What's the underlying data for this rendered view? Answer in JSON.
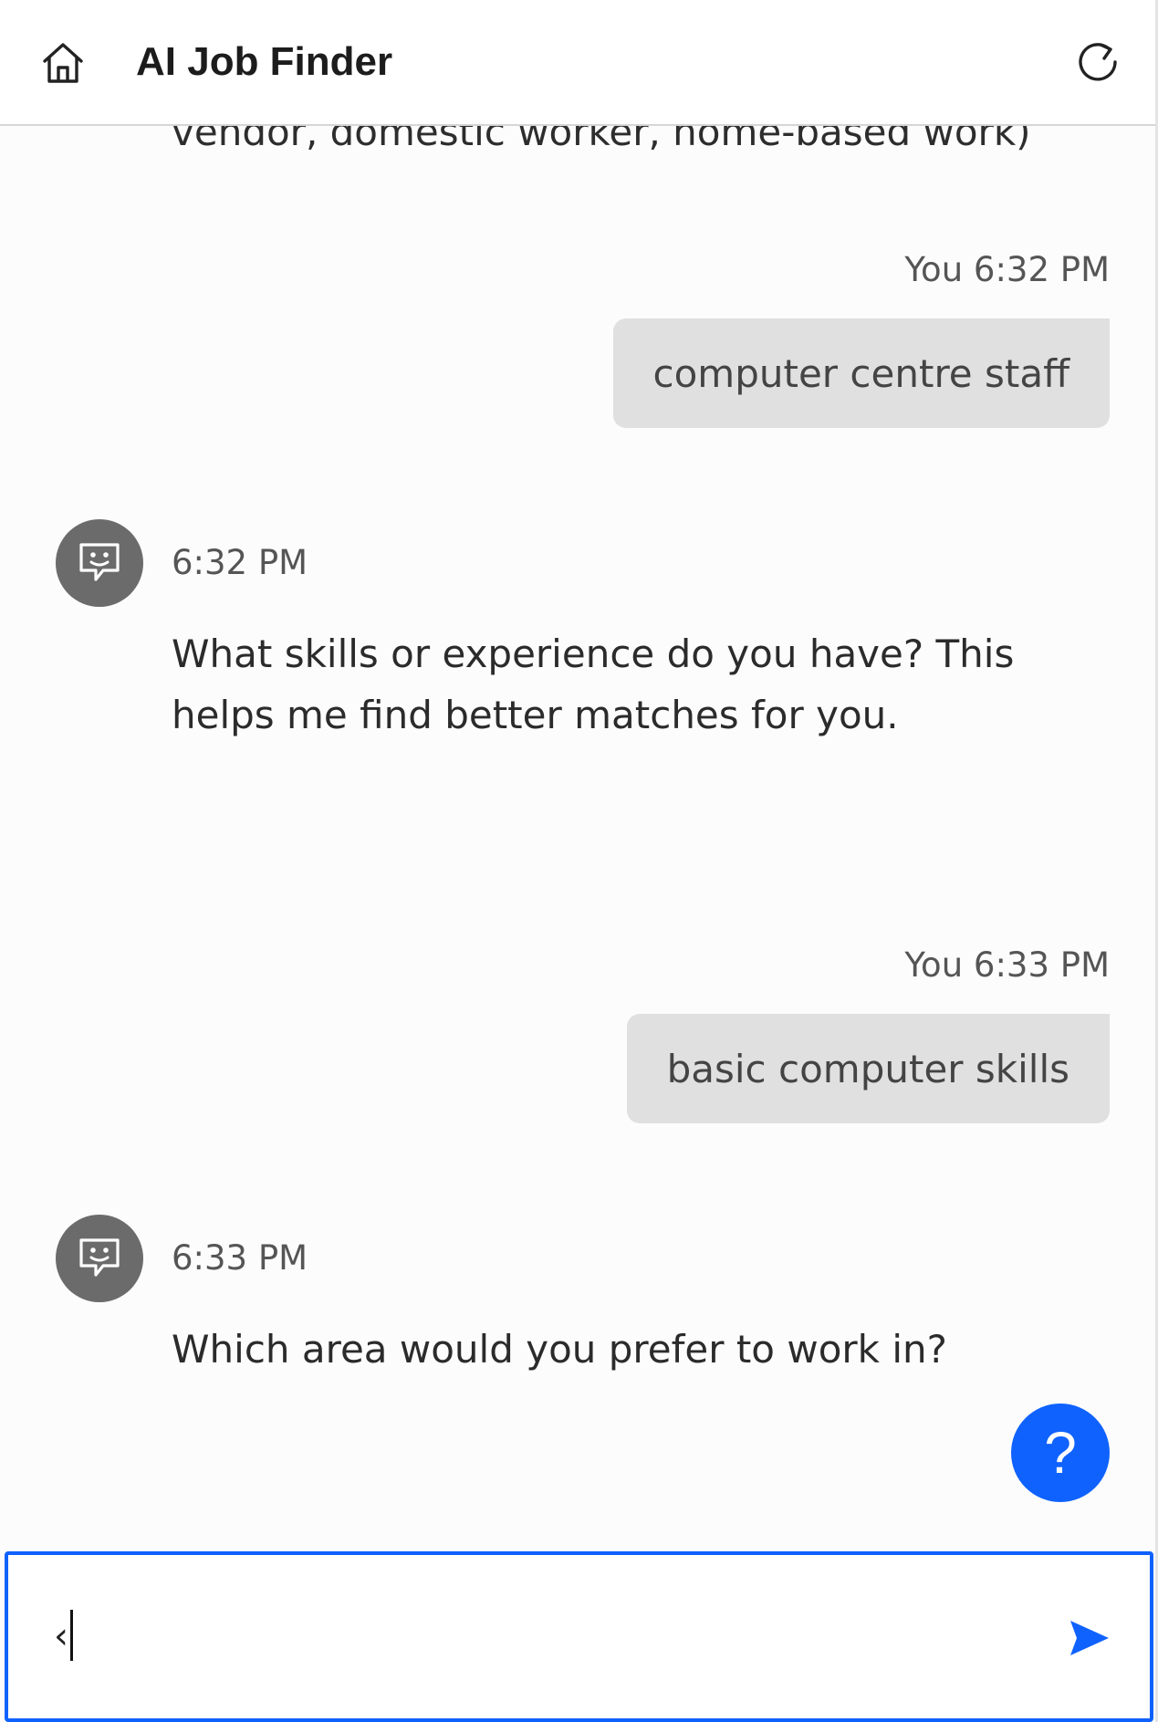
{
  "header": {
    "title": "AI Job Finder",
    "home_icon": "home-icon",
    "refresh_icon": "refresh-icon"
  },
  "chat": {
    "partial_text": "vendor, domestic worker, home-based work)",
    "messages": [
      {
        "sender": "user",
        "meta": "You 6:32 PM",
        "text": "computer centre staff"
      },
      {
        "sender": "bot",
        "time": "6:32 PM",
        "text": "What skills or experience do you have? This helps me find better matches for you."
      },
      {
        "sender": "user",
        "meta": "You 6:33 PM",
        "text": "basic computer skills"
      },
      {
        "sender": "bot",
        "time": "6:33 PM",
        "text": "Which area would you prefer to work in?"
      }
    ]
  },
  "help_button": {
    "label": "?"
  },
  "input": {
    "value": "‹",
    "placeholder": "",
    "send_icon": "send-icon"
  },
  "colors": {
    "accent": "#0f62fe",
    "user_bubble": "#e0e0e0",
    "avatar": "#6b6b6b"
  }
}
